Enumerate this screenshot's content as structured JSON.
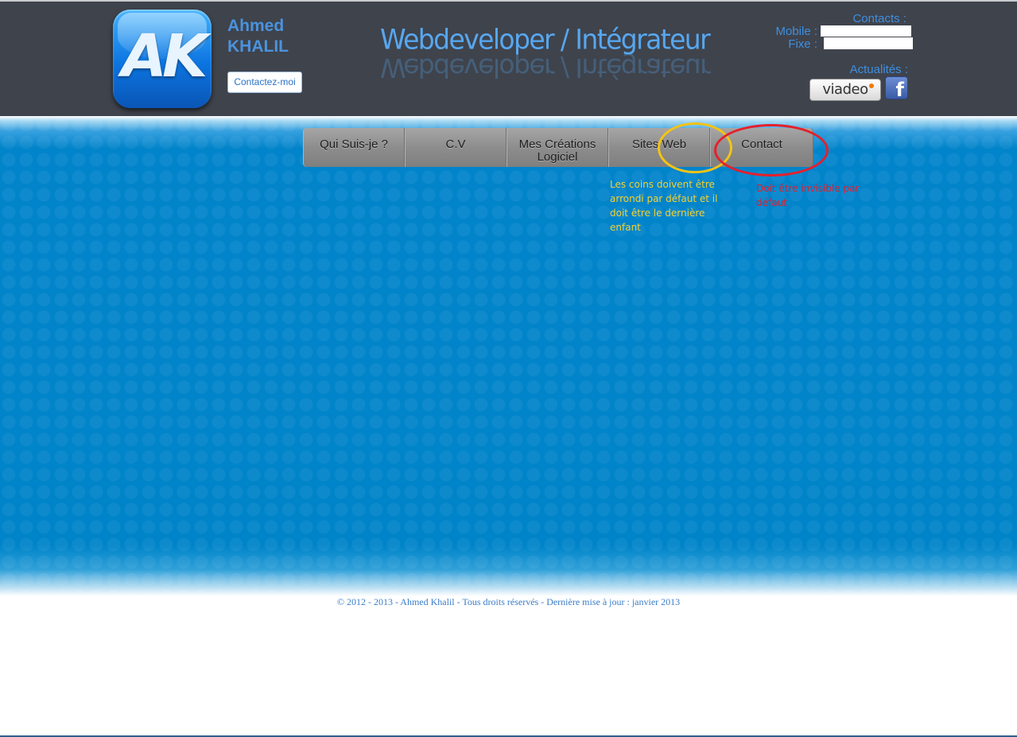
{
  "header": {
    "logo_text": "AK",
    "name_first": "Ahmed",
    "name_last": "KHALIL",
    "contact_button": "Contactez-moi",
    "tagline": "Webdeveloper / Intégrateur",
    "contacts_title": "Contacts :",
    "mobile_label": "Mobile :",
    "fixe_label": "Fixe :",
    "actualites_title": "Actualités :",
    "viadeo_label": "viadeo",
    "facebook_label": "f"
  },
  "menu": {
    "items": [
      {
        "label": "Qui Suis-je ?"
      },
      {
        "label": "C.V"
      },
      {
        "label": "Mes Créations Logiciel"
      },
      {
        "label": "Sites Web"
      },
      {
        "label": "Contact"
      }
    ]
  },
  "annotations": {
    "yellow_note": "Les coins doivent être arrondi par défaut et il doit être le dernière enfant",
    "red_note": "Doit être invisible par défaut",
    "yellow_color": "#f4c316",
    "red_color": "#e4202c"
  },
  "footer": {
    "text": "© 2012 - 2013 - Ahmed Khalil - Tous droits réservés - Dernière mise à jour : janvier 2013"
  },
  "colors": {
    "header_bg": "#3f434c",
    "accent_blue": "#3d8fe0",
    "body_blue": "#0084c9"
  }
}
